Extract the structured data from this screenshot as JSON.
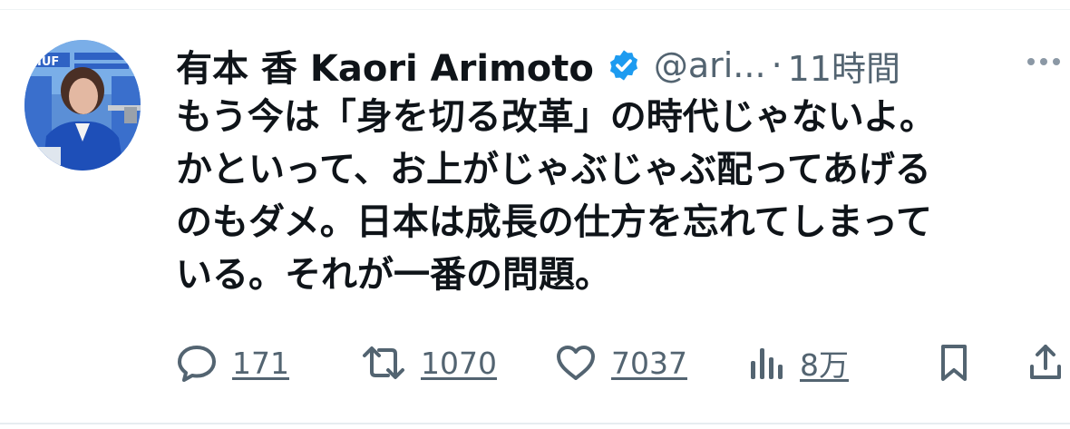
{
  "tweet": {
    "author_name": "有本 香 Kaori Arimoto",
    "handle": "@ari...",
    "separator": "·",
    "time": "11時間",
    "text_lines": [
      "もう今は「身を切る改革」の時代じゃないよ。",
      "かといって、お上がじゃぶじゃぶ配ってあげる",
      "のもダメ。日本は成長の仕方を忘れてしまって",
      "いる。それが一番の問題。"
    ]
  },
  "avatar": {
    "banner_text": "IUF"
  },
  "actions": {
    "reply_count": "171",
    "retweet_count": "1070",
    "like_count": "7037",
    "views_count": "8万"
  },
  "icons": {
    "verified": "verified-badge-icon",
    "more": "more-options-icon",
    "reply": "reply-icon",
    "retweet": "retweet-icon",
    "like": "like-icon",
    "views": "views-icon",
    "bookmark": "bookmark-icon",
    "share": "share-icon"
  },
  "colors": {
    "text": "#0f1419",
    "secondary": "#536471",
    "verified": "#1d9bf0",
    "avatar_blue": "#1e4fb8"
  }
}
